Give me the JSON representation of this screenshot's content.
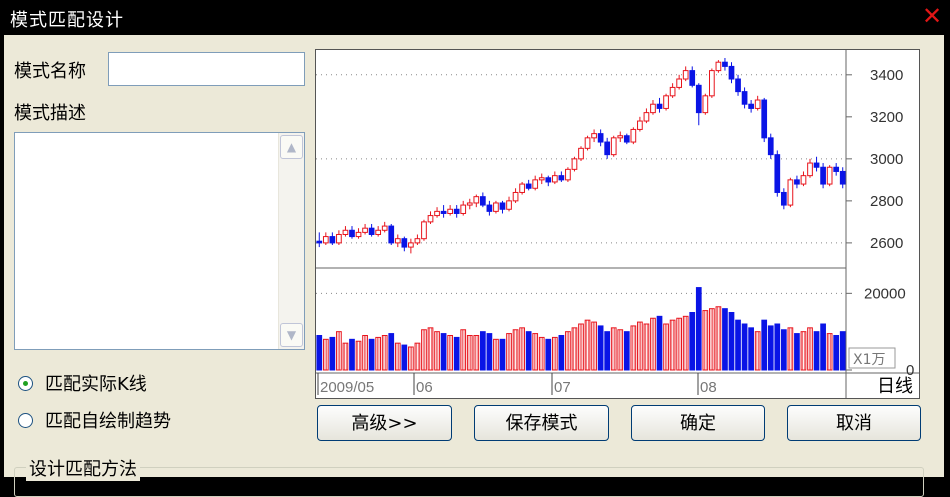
{
  "window": {
    "title": "模式匹配设计",
    "close_icon": "close-icon"
  },
  "form": {
    "name_label": "模式名称",
    "name_value": "",
    "desc_label": "模式描述",
    "desc_value": ""
  },
  "radios": [
    {
      "label": "匹配实际K线",
      "selected": true
    },
    {
      "label": "匹配自绘制趋势",
      "selected": false
    }
  ],
  "buttons": {
    "advanced": "高级>>",
    "save": "保存模式",
    "ok": "确定",
    "cancel": "取消"
  },
  "group": {
    "label": "设计匹配方法"
  },
  "chart_data": {
    "type": "candlestick",
    "period_label": "日线",
    "x_tick_labels": [
      "2009/05",
      "06",
      "07",
      "08"
    ],
    "price_axis": {
      "ticks": [
        2600,
        2800,
        3000,
        3200,
        3400
      ],
      "range": [
        2490,
        3480
      ]
    },
    "volume_axis": {
      "ticks": [
        0,
        20000
      ],
      "unit": "X1万",
      "range": [
        0,
        24000
      ]
    },
    "colors": {
      "up": "#e8141c",
      "down": "#0a14e6",
      "grid": "#888888"
    },
    "candles": [
      [
        2608,
        2600,
        2650,
        2580,
        9000
      ],
      [
        2600,
        2630,
        2650,
        2590,
        8000
      ],
      [
        2630,
        2600,
        2650,
        2590,
        8500
      ],
      [
        2600,
        2640,
        2660,
        2590,
        10000
      ],
      [
        2640,
        2660,
        2680,
        2630,
        7000
      ],
      [
        2660,
        2630,
        2680,
        2620,
        8000
      ],
      [
        2630,
        2650,
        2670,
        2620,
        7500
      ],
      [
        2650,
        2670,
        2690,
        2640,
        9000
      ],
      [
        2670,
        2640,
        2690,
        2630,
        8000
      ],
      [
        2640,
        2660,
        2680,
        2630,
        8500
      ],
      [
        2660,
        2680,
        2700,
        2650,
        9000
      ],
      [
        2680,
        2600,
        2690,
        2590,
        9500
      ],
      [
        2600,
        2620,
        2640,
        2580,
        7000
      ],
      [
        2620,
        2580,
        2630,
        2560,
        6500
      ],
      [
        2580,
        2600,
        2620,
        2550,
        6000
      ],
      [
        2600,
        2620,
        2640,
        2590,
        7000
      ],
      [
        2620,
        2700,
        2710,
        2610,
        10500
      ],
      [
        2700,
        2730,
        2750,
        2690,
        11000
      ],
      [
        2730,
        2750,
        2770,
        2720,
        10000
      ],
      [
        2750,
        2740,
        2780,
        2720,
        9500
      ],
      [
        2740,
        2760,
        2780,
        2730,
        9000
      ],
      [
        2760,
        2740,
        2780,
        2720,
        8500
      ],
      [
        2740,
        2780,
        2800,
        2730,
        10500
      ],
      [
        2780,
        2790,
        2810,
        2760,
        9000
      ],
      [
        2790,
        2820,
        2830,
        2770,
        9000
      ],
      [
        2820,
        2780,
        2840,
        2770,
        10000
      ],
      [
        2780,
        2750,
        2800,
        2730,
        9500
      ],
      [
        2750,
        2790,
        2800,
        2740,
        8000
      ],
      [
        2790,
        2760,
        2800,
        2740,
        8000
      ],
      [
        2760,
        2800,
        2820,
        2750,
        9500
      ],
      [
        2800,
        2840,
        2860,
        2790,
        10500
      ],
      [
        2840,
        2880,
        2890,
        2830,
        11000
      ],
      [
        2880,
        2860,
        2900,
        2850,
        10000
      ],
      [
        2860,
        2900,
        2920,
        2850,
        9500
      ],
      [
        2900,
        2910,
        2930,
        2880,
        8500
      ],
      [
        2910,
        2890,
        2920,
        2870,
        8000
      ],
      [
        2890,
        2920,
        2940,
        2880,
        8500
      ],
      [
        2920,
        2900,
        2940,
        2890,
        9000
      ],
      [
        2900,
        2950,
        2960,
        2890,
        10000
      ],
      [
        2950,
        3000,
        3010,
        2940,
        11000
      ],
      [
        3000,
        3050,
        3060,
        2990,
        12000
      ],
      [
        3050,
        3100,
        3110,
        3040,
        13000
      ],
      [
        3100,
        3120,
        3140,
        3080,
        12500
      ],
      [
        3120,
        3080,
        3140,
        3060,
        11500
      ],
      [
        3080,
        3020,
        3100,
        3000,
        10000
      ],
      [
        3020,
        3100,
        3110,
        3010,
        11000
      ],
      [
        3100,
        3110,
        3130,
        3080,
        10500
      ],
      [
        3110,
        3080,
        3120,
        3070,
        10000
      ],
      [
        3080,
        3140,
        3150,
        3070,
        11500
      ],
      [
        3140,
        3180,
        3200,
        3130,
        12500
      ],
      [
        3180,
        3220,
        3240,
        3170,
        12000
      ],
      [
        3220,
        3260,
        3280,
        3210,
        13500
      ],
      [
        3260,
        3240,
        3290,
        3220,
        14000
      ],
      [
        3240,
        3300,
        3310,
        3230,
        12000
      ],
      [
        3300,
        3340,
        3360,
        3290,
        13000
      ],
      [
        3340,
        3380,
        3400,
        3330,
        13500
      ],
      [
        3380,
        3420,
        3440,
        3370,
        14000
      ],
      [
        3420,
        3350,
        3440,
        3340,
        15000
      ],
      [
        3350,
        3220,
        3360,
        3160,
        21500
      ],
      [
        3220,
        3300,
        3310,
        3210,
        15500
      ],
      [
        3300,
        3420,
        3430,
        3290,
        16000
      ],
      [
        3420,
        3460,
        3470,
        3410,
        16500
      ],
      [
        3460,
        3440,
        3480,
        3420,
        16000
      ],
      [
        3440,
        3380,
        3460,
        3360,
        15000
      ],
      [
        3380,
        3320,
        3400,
        3300,
        13000
      ],
      [
        3320,
        3260,
        3340,
        3240,
        12000
      ],
      [
        3260,
        3240,
        3280,
        3220,
        11000
      ],
      [
        3240,
        3280,
        3300,
        3230,
        10000
      ],
      [
        3280,
        3100,
        3290,
        3080,
        13000
      ],
      [
        3100,
        3020,
        3120,
        3000,
        11500
      ],
      [
        3020,
        2840,
        3040,
        2820,
        12000
      ],
      [
        2840,
        2780,
        2860,
        2760,
        10500
      ],
      [
        2780,
        2900,
        2910,
        2770,
        11000
      ],
      [
        2900,
        2880,
        2920,
        2860,
        9500
      ],
      [
        2880,
        2920,
        2940,
        2870,
        10000
      ],
      [
        2920,
        2980,
        3000,
        2910,
        11000
      ],
      [
        2980,
        2960,
        3010,
        2940,
        10000
      ],
      [
        2960,
        2880,
        2980,
        2860,
        12000
      ],
      [
        2880,
        2960,
        2970,
        2870,
        9500
      ],
      [
        2960,
        2940,
        2980,
        2920,
        9000
      ],
      [
        2940,
        2880,
        2960,
        2860,
        10000
      ]
    ]
  }
}
